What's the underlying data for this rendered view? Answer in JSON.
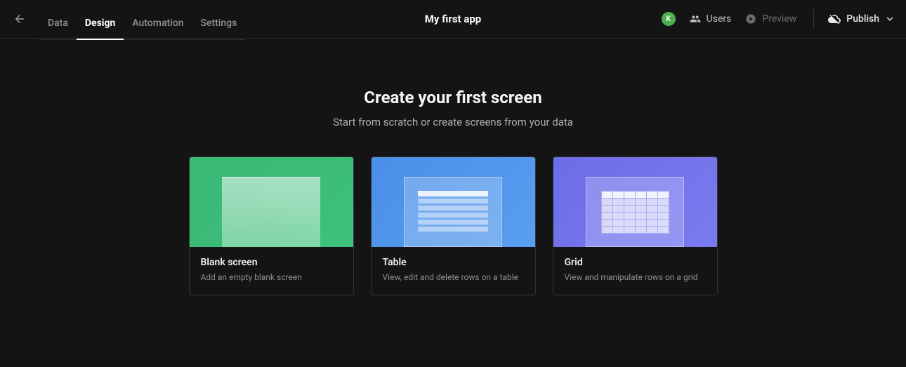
{
  "header": {
    "tabs": {
      "data": "Data",
      "design": "Design",
      "automation": "Automation",
      "settings": "Settings"
    },
    "title": "My first app",
    "avatar_initial": "K",
    "users": "Users",
    "preview": "Preview",
    "publish": "Publish"
  },
  "main": {
    "title": "Create your first screen",
    "subtitle": "Start from scratch or create screens from your data",
    "cards": {
      "blank": {
        "title": "Blank screen",
        "desc": "Add an empty blank screen"
      },
      "table": {
        "title": "Table",
        "desc": "View, edit and delete rows on a table"
      },
      "grid": {
        "title": "Grid",
        "desc": "View and manipulate rows on a grid"
      }
    }
  }
}
